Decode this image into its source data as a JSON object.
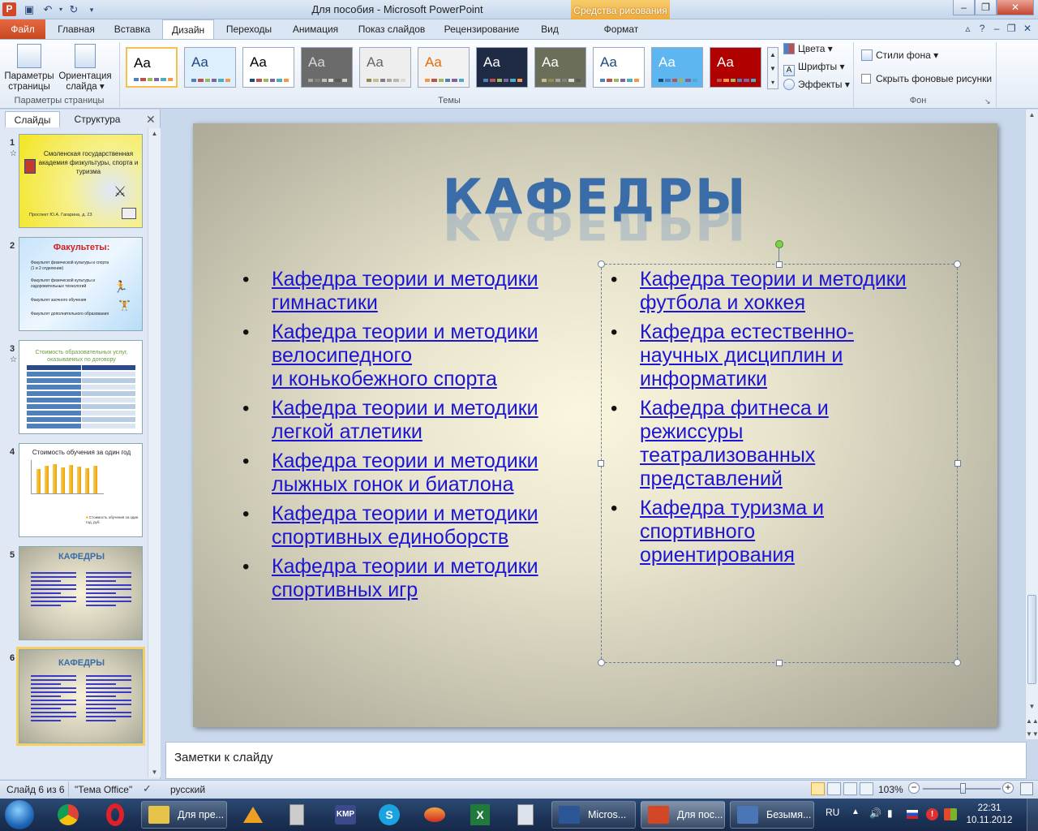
{
  "window": {
    "title": "Для пособия - Microsoft PowerPoint",
    "context_tab_group": "Средства рисования",
    "app_icon": "P"
  },
  "ribbon_tabs": [
    "Файл",
    "Главная",
    "Вставка",
    "Дизайн",
    "Переходы",
    "Анимация",
    "Показ слайдов",
    "Рецензирование",
    "Вид",
    "Формат"
  ],
  "active_tab": "Дизайн",
  "ribbon": {
    "page_setup": {
      "btn_params": "Параметры страницы",
      "btn_orientation": "Ориентация слайда",
      "group_label": "Параметры страницы"
    },
    "themes": {
      "group_label": "Темы",
      "sample_text": "Aa"
    },
    "theme_options": {
      "colors": "Цвета",
      "fonts": "Шрифты",
      "effects": "Эффекты"
    },
    "background": {
      "styles": "Стили фона",
      "hide_graphics": "Скрыть фоновые рисунки",
      "group_label": "Фон"
    }
  },
  "theme_colors": [
    {
      "bg": "#ffffff",
      "fg": "#000000",
      "bars": [
        "#4f81bd",
        "#c0504d",
        "#9bbb59",
        "#8064a2",
        "#4bacc6",
        "#f79646"
      ]
    },
    {
      "bg": "#ddeefc",
      "fg": "#1f497d",
      "bars": [
        "#4f81bd",
        "#c0504d",
        "#9bbb59",
        "#8064a2",
        "#4bacc6",
        "#f79646"
      ]
    },
    {
      "bg": "#ffffff",
      "fg": "#000000",
      "bars": [
        "#1f497d",
        "#c0504d",
        "#9bbb59",
        "#8064a2",
        "#4bacc6",
        "#f79646"
      ]
    },
    {
      "bg": "#6b6b6b",
      "fg": "#d8d8d8",
      "bars": [
        "#a5a5a5",
        "#7f7f7f",
        "#bfbfbf",
        "#d8d8d8",
        "#595959",
        "#cccccc"
      ]
    },
    {
      "bg": "#eeeeee",
      "fg": "#666666",
      "bars": [
        "#938953",
        "#c4bd97",
        "#7f7f7f",
        "#a5a5a5",
        "#b7b7b7",
        "#d8d8d8"
      ]
    },
    {
      "bg": "#f2f2f2",
      "fg": "#e46c0a",
      "bars": [
        "#f79646",
        "#c0504d",
        "#9bbb59",
        "#4f81bd",
        "#8064a2",
        "#4bacc6"
      ]
    },
    {
      "bg": "#1f2a44",
      "fg": "#ffffff",
      "bars": [
        "#4f81bd",
        "#c0504d",
        "#9bbb59",
        "#8064a2",
        "#4bacc6",
        "#f79646"
      ]
    },
    {
      "bg": "#6b6f5a",
      "fg": "#ffffff",
      "bars": [
        "#c4bd97",
        "#938953",
        "#a5a5a5",
        "#7f7f7f",
        "#d8d8d8",
        "#595959"
      ]
    },
    {
      "bg": "#ffffff",
      "fg": "#1f497d",
      "bars": [
        "#4f81bd",
        "#c0504d",
        "#9bbb59",
        "#8064a2",
        "#4bacc6",
        "#f79646"
      ]
    },
    {
      "bg": "#5db6f0",
      "fg": "#ffffff",
      "bars": [
        "#1f497d",
        "#4f81bd",
        "#c0504d",
        "#9bbb59",
        "#8064a2",
        "#4bacc6"
      ]
    },
    {
      "bg": "#b00000",
      "fg": "#ffffff",
      "bars": [
        "#c0504d",
        "#f79646",
        "#9bbb59",
        "#4f81bd",
        "#8064a2",
        "#4bacc6"
      ]
    }
  ],
  "pane_tabs": {
    "slides": "Слайды",
    "outline": "Структура"
  },
  "thumbnails": [
    {
      "num": "1",
      "star": "☆",
      "title": "Смоленская государственная академия физкультуры, спорта и туризма",
      "footer": "Проспект Ю.А. Гагарина, д. 23"
    },
    {
      "num": "2",
      "star": "",
      "title": "Факультеты:",
      "items": [
        "Факультет физической культуры и спорта (1 и 2 отделение)",
        "Факультет физической культуры и оздоровительных технологий",
        "Факультет заочного обучения",
        "Факультет дополнительного образования"
      ]
    },
    {
      "num": "3",
      "star": "☆",
      "title": "Стоимость образовательных услуг, оказываемых по договору"
    },
    {
      "num": "4",
      "star": "",
      "title": "Стоимость обучения за один год",
      "legend": "Стоимость обучения за один год, руб."
    },
    {
      "num": "5",
      "star": "",
      "title": "КАФЕДРЫ"
    },
    {
      "num": "6",
      "star": "",
      "title": "КАФЕДРЫ"
    }
  ],
  "slide": {
    "title": "КАФЕДРЫ",
    "left_column": [
      [
        "Кафедра теории и методики",
        "гимнастики"
      ],
      [
        "Кафедра теории и методики",
        "велосипедного",
        "и конькобежного спорта"
      ],
      [
        "Кафедра теории и методики",
        "легкой атлетики"
      ],
      [
        "Кафедра теории и методики",
        "лыжных гонок и биатлона"
      ],
      [
        "Кафедра теории и методики",
        "спортивных единоборств"
      ],
      [
        "Кафедра теории и методики",
        "спортивных игр"
      ]
    ],
    "right_column": [
      [
        "Кафедра теории и методики",
        "футбола и хоккея"
      ],
      [
        "Кафедра естественно-",
        "научных дисциплин и",
        "информатики"
      ],
      [
        "Кафедра фитнеса и",
        "режиссуры",
        "театрализованных",
        "представлений"
      ],
      [
        "Кафедра туризма и",
        "спортивного",
        "ориентирования"
      ]
    ]
  },
  "notes_placeholder": "Заметки к слайду",
  "status": {
    "slide_counter": "Слайд 6 из 6",
    "theme_name": "\"Тема Office\"",
    "language": "русский",
    "zoom": "103%",
    "zoom_fraction": 0.52
  },
  "taskbar": {
    "tasks": [
      {
        "label": "Для пре...",
        "color": "#e8c34a"
      },
      {
        "label": "Micros...",
        "color": "#2b5797"
      },
      {
        "label": "Для пос...",
        "color": "#d24726"
      },
      {
        "label": "Безымя...",
        "color": "#4a76b8"
      }
    ],
    "lang": "RU",
    "time": "22:31",
    "date": "10.11.2012"
  }
}
